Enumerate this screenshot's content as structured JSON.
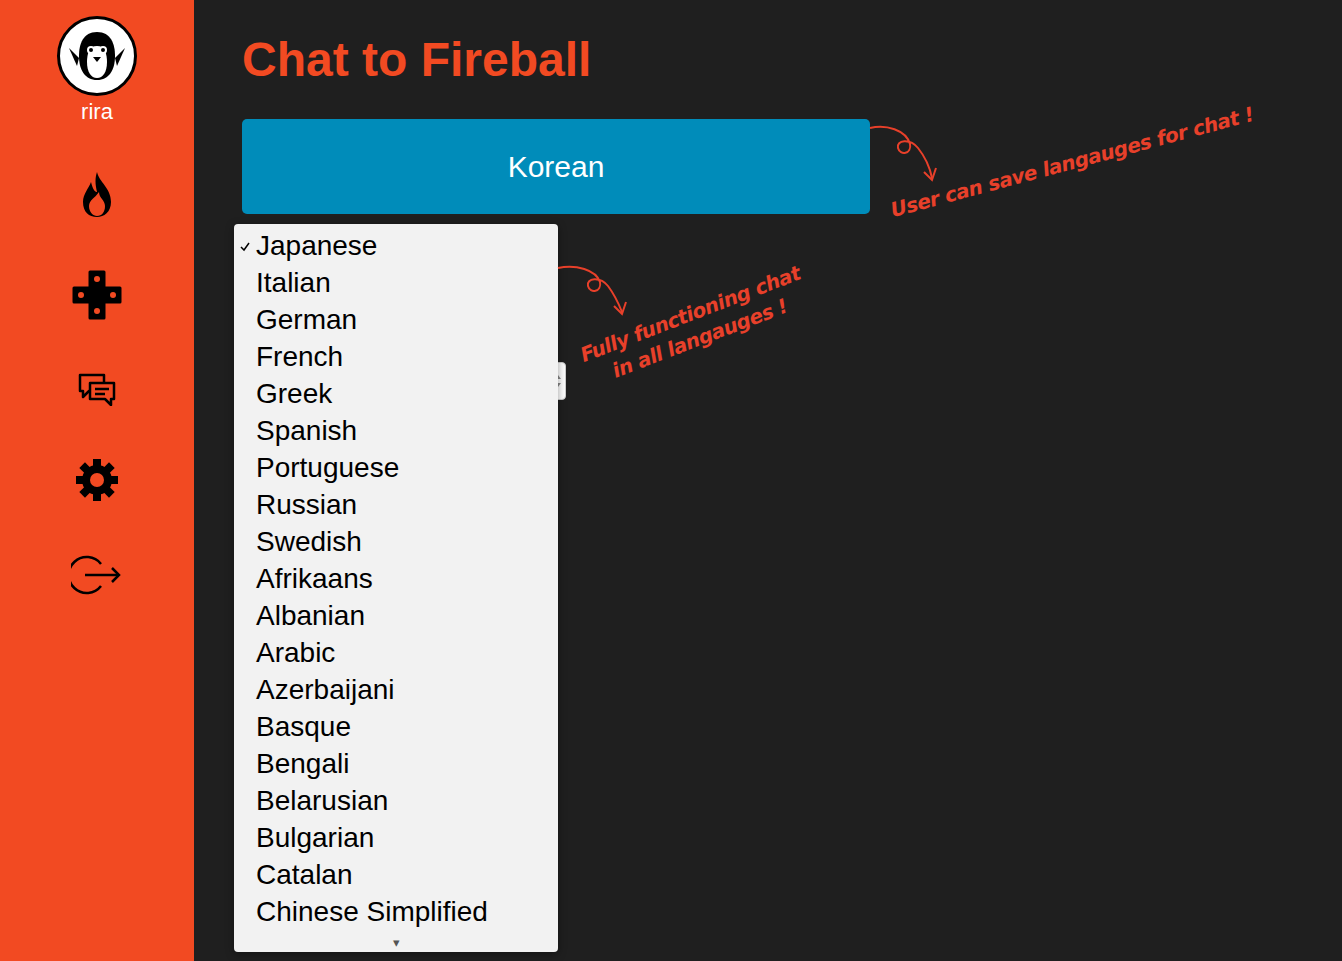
{
  "sidebar": {
    "user": "rira"
  },
  "title": "Chat to Fireball",
  "language_button": {
    "label": "Korean"
  },
  "dropdown": {
    "options": [
      {
        "label": "Japanese",
        "selected": true
      },
      {
        "label": "Italian",
        "selected": false
      },
      {
        "label": "German",
        "selected": false
      },
      {
        "label": "French",
        "selected": false
      },
      {
        "label": "Greek",
        "selected": false
      },
      {
        "label": "Spanish",
        "selected": false
      },
      {
        "label": "Portuguese",
        "selected": false
      },
      {
        "label": "Russian",
        "selected": false
      },
      {
        "label": "Swedish",
        "selected": false
      },
      {
        "label": "Afrikaans",
        "selected": false
      },
      {
        "label": "Albanian",
        "selected": false
      },
      {
        "label": "Arabic",
        "selected": false
      },
      {
        "label": "Azerbaijani",
        "selected": false
      },
      {
        "label": "Basque",
        "selected": false
      },
      {
        "label": "Bengali",
        "selected": false
      },
      {
        "label": "Belarusian",
        "selected": false
      },
      {
        "label": "Bulgarian",
        "selected": false
      },
      {
        "label": "Catalan",
        "selected": false
      },
      {
        "label": "Chinese Simplified",
        "selected": false
      }
    ],
    "scroll_indicator": "▾"
  },
  "annotations": [
    {
      "lines": [
        "User can save langauges for chat !"
      ]
    },
    {
      "lines": [
        "Fully functioning chat",
        "in all langauges !"
      ]
    }
  ]
}
